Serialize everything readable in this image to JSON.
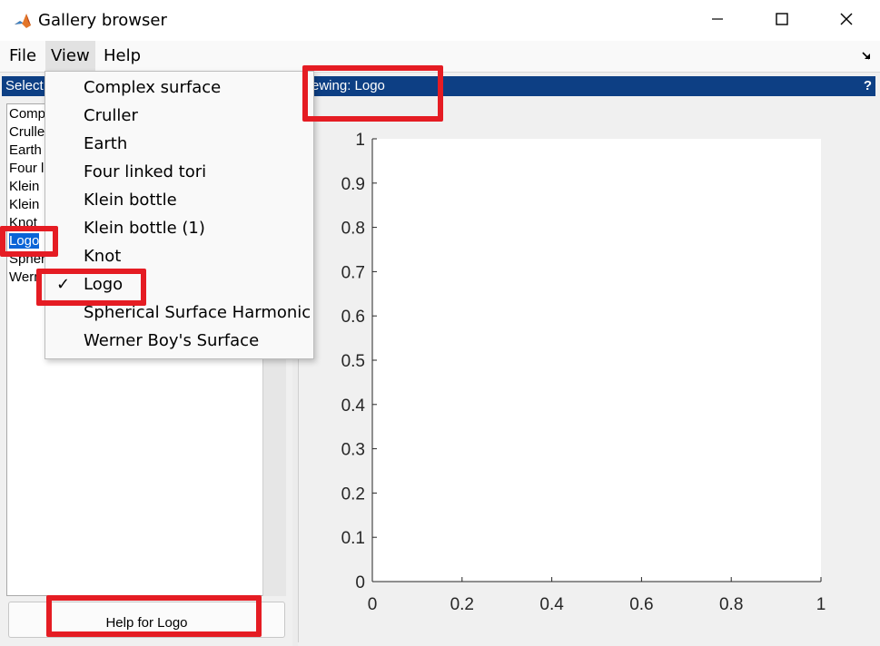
{
  "window": {
    "title": "Gallery browser",
    "icon": "matlab-icon",
    "controls": {
      "minimize": "minimize-icon",
      "maximize": "maximize-icon",
      "close": "close-icon"
    }
  },
  "menubar": {
    "items": [
      "File",
      "View",
      "Help"
    ],
    "active": "View"
  },
  "left_panel": {
    "header": "Select",
    "list": [
      {
        "label": "Comp"
      },
      {
        "label": "Crulle"
      },
      {
        "label": "Earth"
      },
      {
        "label": "Four l"
      },
      {
        "label": "Klein"
      },
      {
        "label": "Klein"
      },
      {
        "label": "Knot"
      },
      {
        "label": "Logo",
        "selected": true
      },
      {
        "label": "Spher"
      },
      {
        "label": "Wern"
      }
    ],
    "help_button": "Help for Logo"
  },
  "right_panel": {
    "header": "ewing: Logo",
    "help_glyph": "?"
  },
  "view_menu": {
    "items": [
      {
        "label": "Complex surface"
      },
      {
        "label": "Cruller"
      },
      {
        "label": "Earth"
      },
      {
        "label": "Four linked tori"
      },
      {
        "label": "Klein bottle"
      },
      {
        "label": "Klein bottle (1)"
      },
      {
        "label": "Knot"
      },
      {
        "label": "Logo",
        "checked": true
      },
      {
        "label": "Spherical Surface Harmonic"
      },
      {
        "label": "Werner Boy's Surface"
      }
    ],
    "check_glyph": "✓"
  },
  "highlight_color": "#e51c23",
  "chart_data": {
    "type": "line",
    "title": "",
    "xlabel": "",
    "ylabel": "",
    "xlim": [
      0,
      1
    ],
    "ylim": [
      0,
      1
    ],
    "xticks": [
      "0",
      "0.2",
      "0.4",
      "0.6",
      "0.8",
      "1"
    ],
    "yticks": [
      "0",
      "0.1",
      "0.2",
      "0.3",
      "0.4",
      "0.5",
      "0.6",
      "0.7",
      "0.8",
      "0.9",
      "1"
    ],
    "series": [],
    "grid": false
  }
}
